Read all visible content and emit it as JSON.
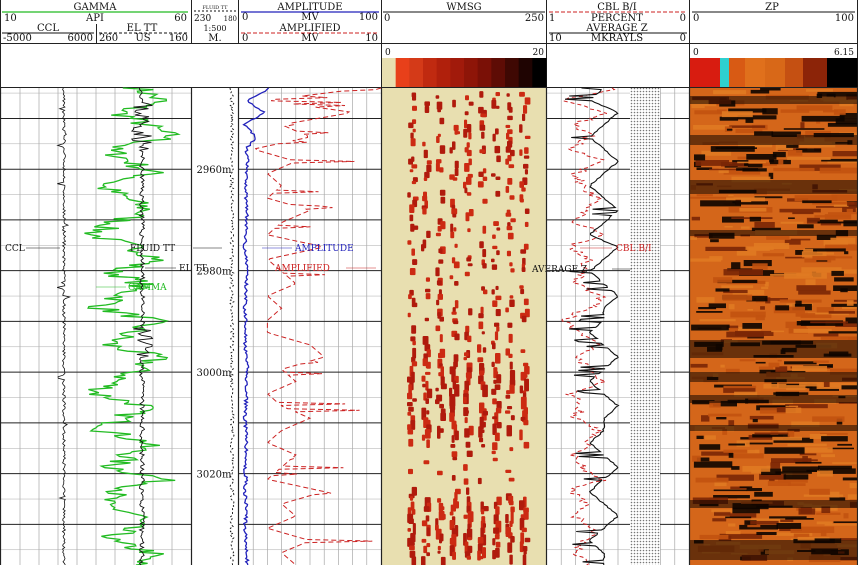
{
  "colors": {
    "gamma": "#22bb22",
    "amplitude": "#2222bb",
    "cbl": "#cc2222",
    "black": "#111111",
    "wmsg_bg": "#e8dfb0",
    "zp_base": "#d4661a"
  },
  "header": {
    "gamma": {
      "title": "GAMMA",
      "min": "10",
      "unit": "API",
      "max": "60"
    },
    "ccl": {
      "title": "CCL",
      "min": "-5000",
      "max": "6000"
    },
    "el_tt": {
      "title": "EL TT",
      "min": "260",
      "unit": "US",
      "max": "160"
    },
    "fluid_tt": {
      "title": "FLUID TT",
      "min": "230",
      "max": "180"
    },
    "depth": {
      "scale": "1:500",
      "unit": "M."
    },
    "amplitude": {
      "title": "AMPLITUDE",
      "min": "0",
      "unit": "MV",
      "max": "100"
    },
    "amplified": {
      "title": "AMPLIFIED",
      "min": "0",
      "unit": "MV",
      "max": "10"
    },
    "wmsg": {
      "title": "WMSG",
      "min": "0",
      "max": "250",
      "scale_min": "0",
      "scale_max": "20"
    },
    "cbl": {
      "title": "CBL B/I",
      "min": "1",
      "unit": "PERCENT",
      "max": "0"
    },
    "avg_z": {
      "title": "AVERAGE Z",
      "min": "10",
      "unit": "MKRAYLS",
      "max": "0"
    },
    "zp": {
      "title": "ZP",
      "min": "0",
      "max": "100",
      "scale_min": "0",
      "scale_max": "6.15"
    }
  },
  "labels": {
    "ccl": "CCL",
    "fluid_tt": "FLUID TT",
    "el_tt": "EL TT",
    "gamma": "GAMMA",
    "amplitude": "AMPLITUDE",
    "amplified": "AMPLIFIED",
    "average_z": "AVERAGE Z",
    "cbl": "CBL B/I"
  },
  "chart_data": {
    "type": "line",
    "title": "",
    "depth_unit": "m",
    "depth_range": [
      2944,
      3038
    ],
    "depth_ticks": [
      "2960m",
      "2980m",
      "3000m",
      "3020m"
    ],
    "series": [
      {
        "name": "GAMMA",
        "unit": "API",
        "range": [
          10,
          60
        ],
        "values": [
          46,
          52,
          41,
          48,
          55,
          38,
          44,
          50,
          36,
          43,
          49,
          40,
          34,
          45,
          52,
          39,
          47,
          42,
          36,
          50,
          44,
          38,
          51,
          46,
          40,
          35,
          48,
          42,
          37,
          49,
          44,
          39,
          53,
          41,
          36,
          47,
          43,
          38,
          50,
          45
        ]
      },
      {
        "name": "AMPLITUDE",
        "unit": "MV",
        "range": [
          0,
          100
        ],
        "values": [
          22,
          5,
          18,
          4,
          12,
          5,
          6,
          5,
          5,
          5,
          6,
          5,
          5,
          4,
          5,
          6,
          5,
          5,
          4,
          5,
          5,
          4,
          5,
          6,
          5,
          5,
          5,
          4,
          5,
          5,
          5,
          4,
          5,
          4,
          5,
          5,
          4,
          5,
          5,
          6
        ]
      },
      {
        "name": "AMPLIFIED",
        "unit": "MV",
        "range": [
          0,
          10
        ],
        "values": [
          9,
          2,
          8,
          3,
          5,
          1,
          4,
          2,
          3,
          2,
          5,
          3,
          2,
          6,
          2,
          3,
          4,
          2,
          3,
          2,
          2,
          5,
          6,
          3,
          4,
          2,
          3,
          5,
          3,
          2,
          4,
          3,
          2,
          6,
          3,
          4,
          2,
          5,
          3,
          4
        ]
      },
      {
        "name": "CBL B/I",
        "unit": "PERCENT",
        "range": [
          1,
          0
        ],
        "values": [
          0.5,
          0.9,
          0.6,
          0.8,
          0.7,
          0.85,
          0.6,
          0.8,
          0.75,
          0.65,
          0.7,
          0.8,
          0.6,
          0.85,
          0.7,
          0.75,
          0.8,
          0.6,
          0.7,
          0.9,
          0.75,
          0.65,
          0.8,
          0.7,
          0.6,
          0.85,
          0.75,
          0.8,
          0.65,
          0.7,
          0.8,
          0.75,
          0.6,
          0.85,
          0.7,
          0.8,
          0.65,
          0.75,
          0.8,
          0.7
        ]
      },
      {
        "name": "AVERAGE Z",
        "unit": "MKRAYLS",
        "range": [
          10,
          0
        ],
        "values": [
          6,
          7,
          5,
          6,
          7,
          6,
          5,
          6,
          7,
          6,
          5,
          6,
          7,
          5,
          6,
          7,
          6,
          5,
          6,
          6,
          7,
          6,
          5,
          6,
          7,
          6,
          5,
          6,
          6,
          7,
          6,
          5,
          6,
          7,
          6,
          5,
          6,
          7,
          6,
          6
        ]
      }
    ]
  }
}
